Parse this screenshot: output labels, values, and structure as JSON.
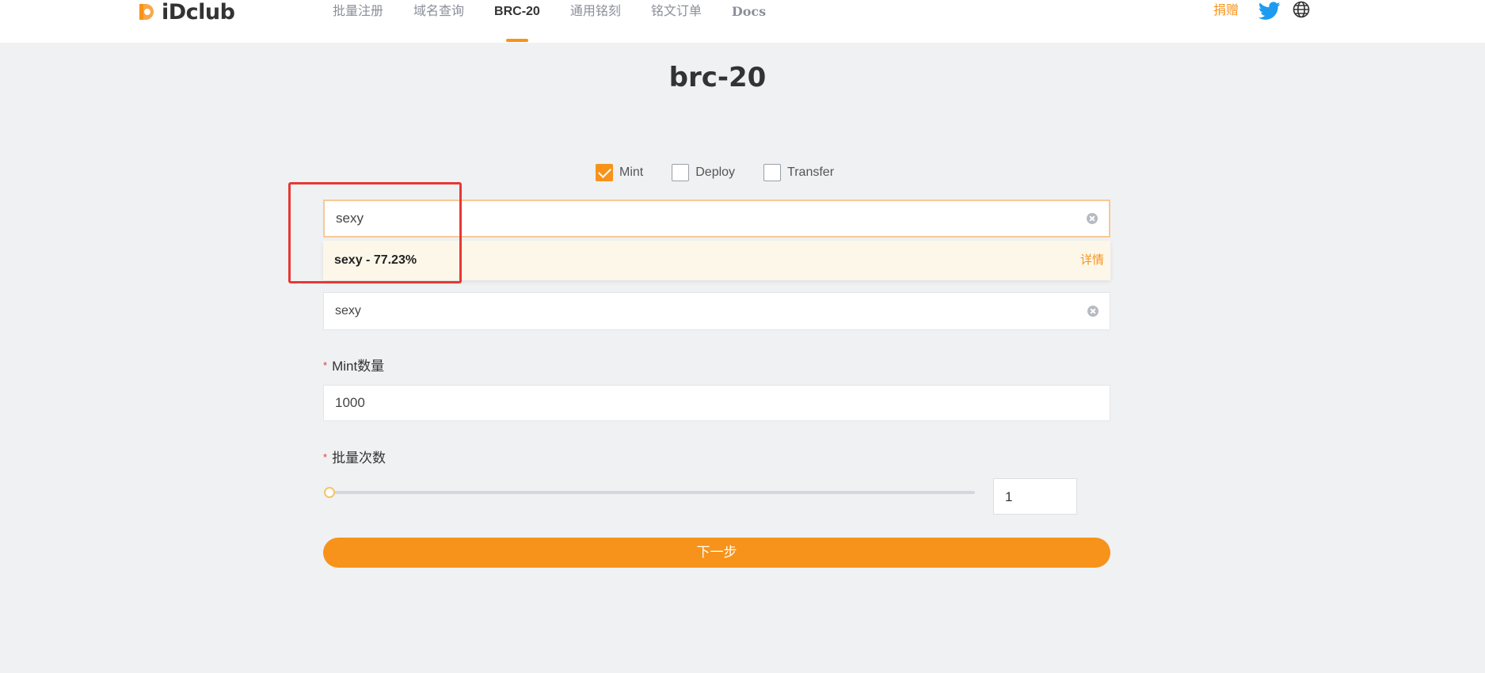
{
  "brand": {
    "name": "iDclub",
    "accent": "#f7931a"
  },
  "nav": {
    "items": [
      {
        "label": "批量注册"
      },
      {
        "label": "域名查询"
      },
      {
        "label": "BRC-20",
        "active": true
      },
      {
        "label": "通用铭刻"
      },
      {
        "label": "铭文订单"
      },
      {
        "label": "Docs"
      }
    ],
    "donate": "捐赠",
    "icons": [
      "twitter-icon",
      "globe-icon"
    ]
  },
  "page": {
    "title": "brc-20"
  },
  "options": [
    {
      "label": "Mint",
      "checked": true
    },
    {
      "label": "Deploy",
      "checked": false
    },
    {
      "label": "Transfer",
      "checked": false
    }
  ],
  "search": {
    "value": "sexy"
  },
  "suggestion": {
    "text": "sexy - 77.23%",
    "link": "详情"
  },
  "ticker_field": {
    "value": "sexy"
  },
  "mint_amount": {
    "label": "Mint数量",
    "value": "1000",
    "required_mark": "*"
  },
  "batch_count": {
    "label": "批量次数",
    "value": "1",
    "required_mark": "*",
    "slider_level": 0
  },
  "next_button": {
    "label": "下一步"
  }
}
